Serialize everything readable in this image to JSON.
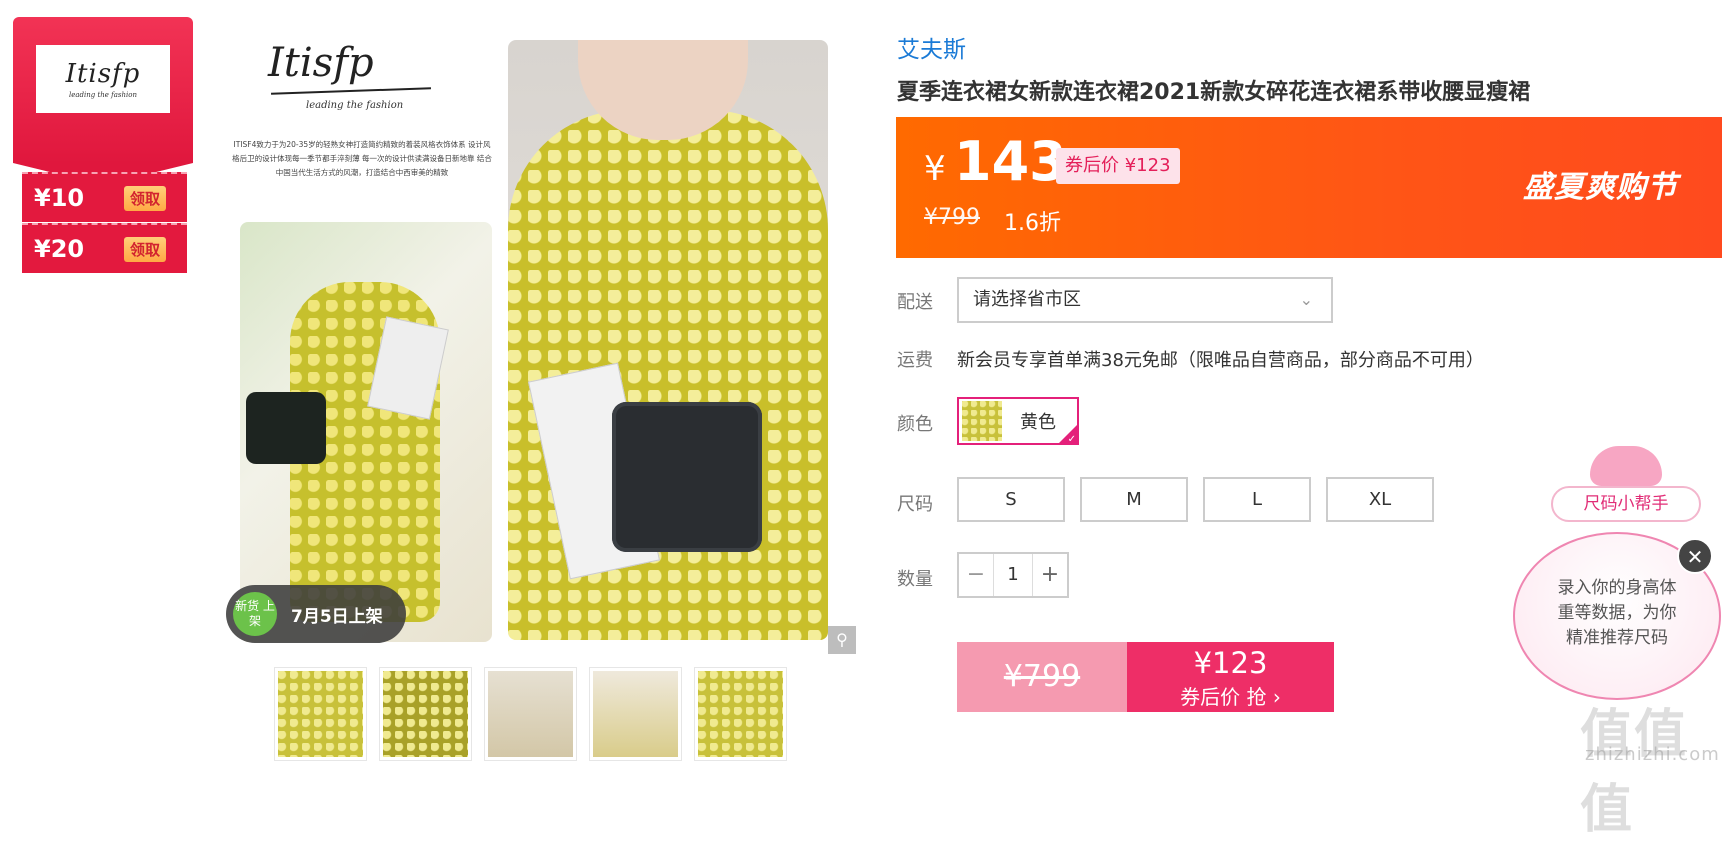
{
  "coupon_panel": {
    "brand_logo": "Itisfp",
    "brand_tagline": "leading the fashion",
    "coupons": [
      {
        "value": "¥10",
        "button": "领取"
      },
      {
        "value": "¥20",
        "button": "领取"
      }
    ]
  },
  "gallery": {
    "logo": "Itisfp",
    "tagline": "leading the fashion",
    "description": "ITISF4致力于为20-35岁的轻熟女神打造简约精致的着装风格衣饰体系 设计风格后卫的设计体现每一季节都手淬刻薄 每一次的设计供读满设备日新地靠 结合中国当代生活方式的风潮，打造结合中西审美的精致",
    "new_badge_circle": "新货 上架",
    "new_badge_text": "7月5日上架",
    "zoom_icon": "magnifier-icon",
    "thumbnails_count": 5
  },
  "product": {
    "shop_name": "艾夫斯",
    "title": "夏季连衣裙女新款连衣裙2021新款女碎花连衣裙系带收腰显瘦裙",
    "currency": "¥",
    "price": "143",
    "after_coupon_tag": "券后价 ¥123",
    "original_price": "¥799",
    "discount": "1.6折",
    "promo": "盛夏爽购节"
  },
  "options": {
    "delivery_label": "配送",
    "region_placeholder": "请选择省市区",
    "shipping_label": "运费",
    "shipping_text": "新会员专享首单满38元免邮（限唯品自营商品，部分商品不可用）",
    "color_label": "颜色",
    "color_value": "黄色",
    "size_label": "尺码",
    "sizes": [
      "S",
      "M",
      "L",
      "XL"
    ],
    "qty_label": "数量",
    "qty_minus": "−",
    "qty_value": "1",
    "qty_plus": "+"
  },
  "buy": {
    "original": "¥799",
    "price": "¥123",
    "sub": "券后价 抢 ›"
  },
  "helper": {
    "label": "尺码小帮手",
    "bubble": "录入你的身高体重等数据，为你精准推荐尺码",
    "close": "✕"
  },
  "watermark": {
    "main": "值值值",
    "sub": "zhizhizhi.com"
  },
  "colors": {
    "accent_red": "#e3193e",
    "price_orange": "#ff5516",
    "shop_blue": "#1a7ad6",
    "buy_pink": "#ee2e67"
  }
}
